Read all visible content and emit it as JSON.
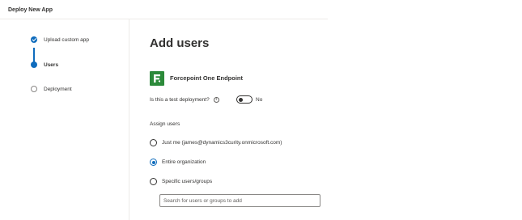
{
  "header": {
    "title": "Deploy New App"
  },
  "steps": [
    {
      "label": "Upload custom app",
      "state": "completed"
    },
    {
      "label": "Users",
      "state": "current"
    },
    {
      "label": "Deployment",
      "state": "pending"
    }
  ],
  "main": {
    "title": "Add users",
    "app": {
      "name": "Forcepoint One Endpoint",
      "logo_color": "#2c8a3a",
      "icon": "forcepoint-logo-icon"
    },
    "test_deployment": {
      "label": "Is this a test deployment?",
      "toggle_text": "No",
      "value": false
    },
    "assign": {
      "label": "Assign users",
      "options": [
        {
          "label": "Just me (james@dynamics3curity.onmicrosoft.com)",
          "selected": false
        },
        {
          "label": "Entire organization",
          "selected": true
        },
        {
          "label": "Specific users/groups",
          "selected": false
        }
      ],
      "search_placeholder": "Search for users or groups to add"
    }
  },
  "colors": {
    "accent": "#0f6cbd",
    "text": "#323130",
    "divider": "#edebe9"
  }
}
